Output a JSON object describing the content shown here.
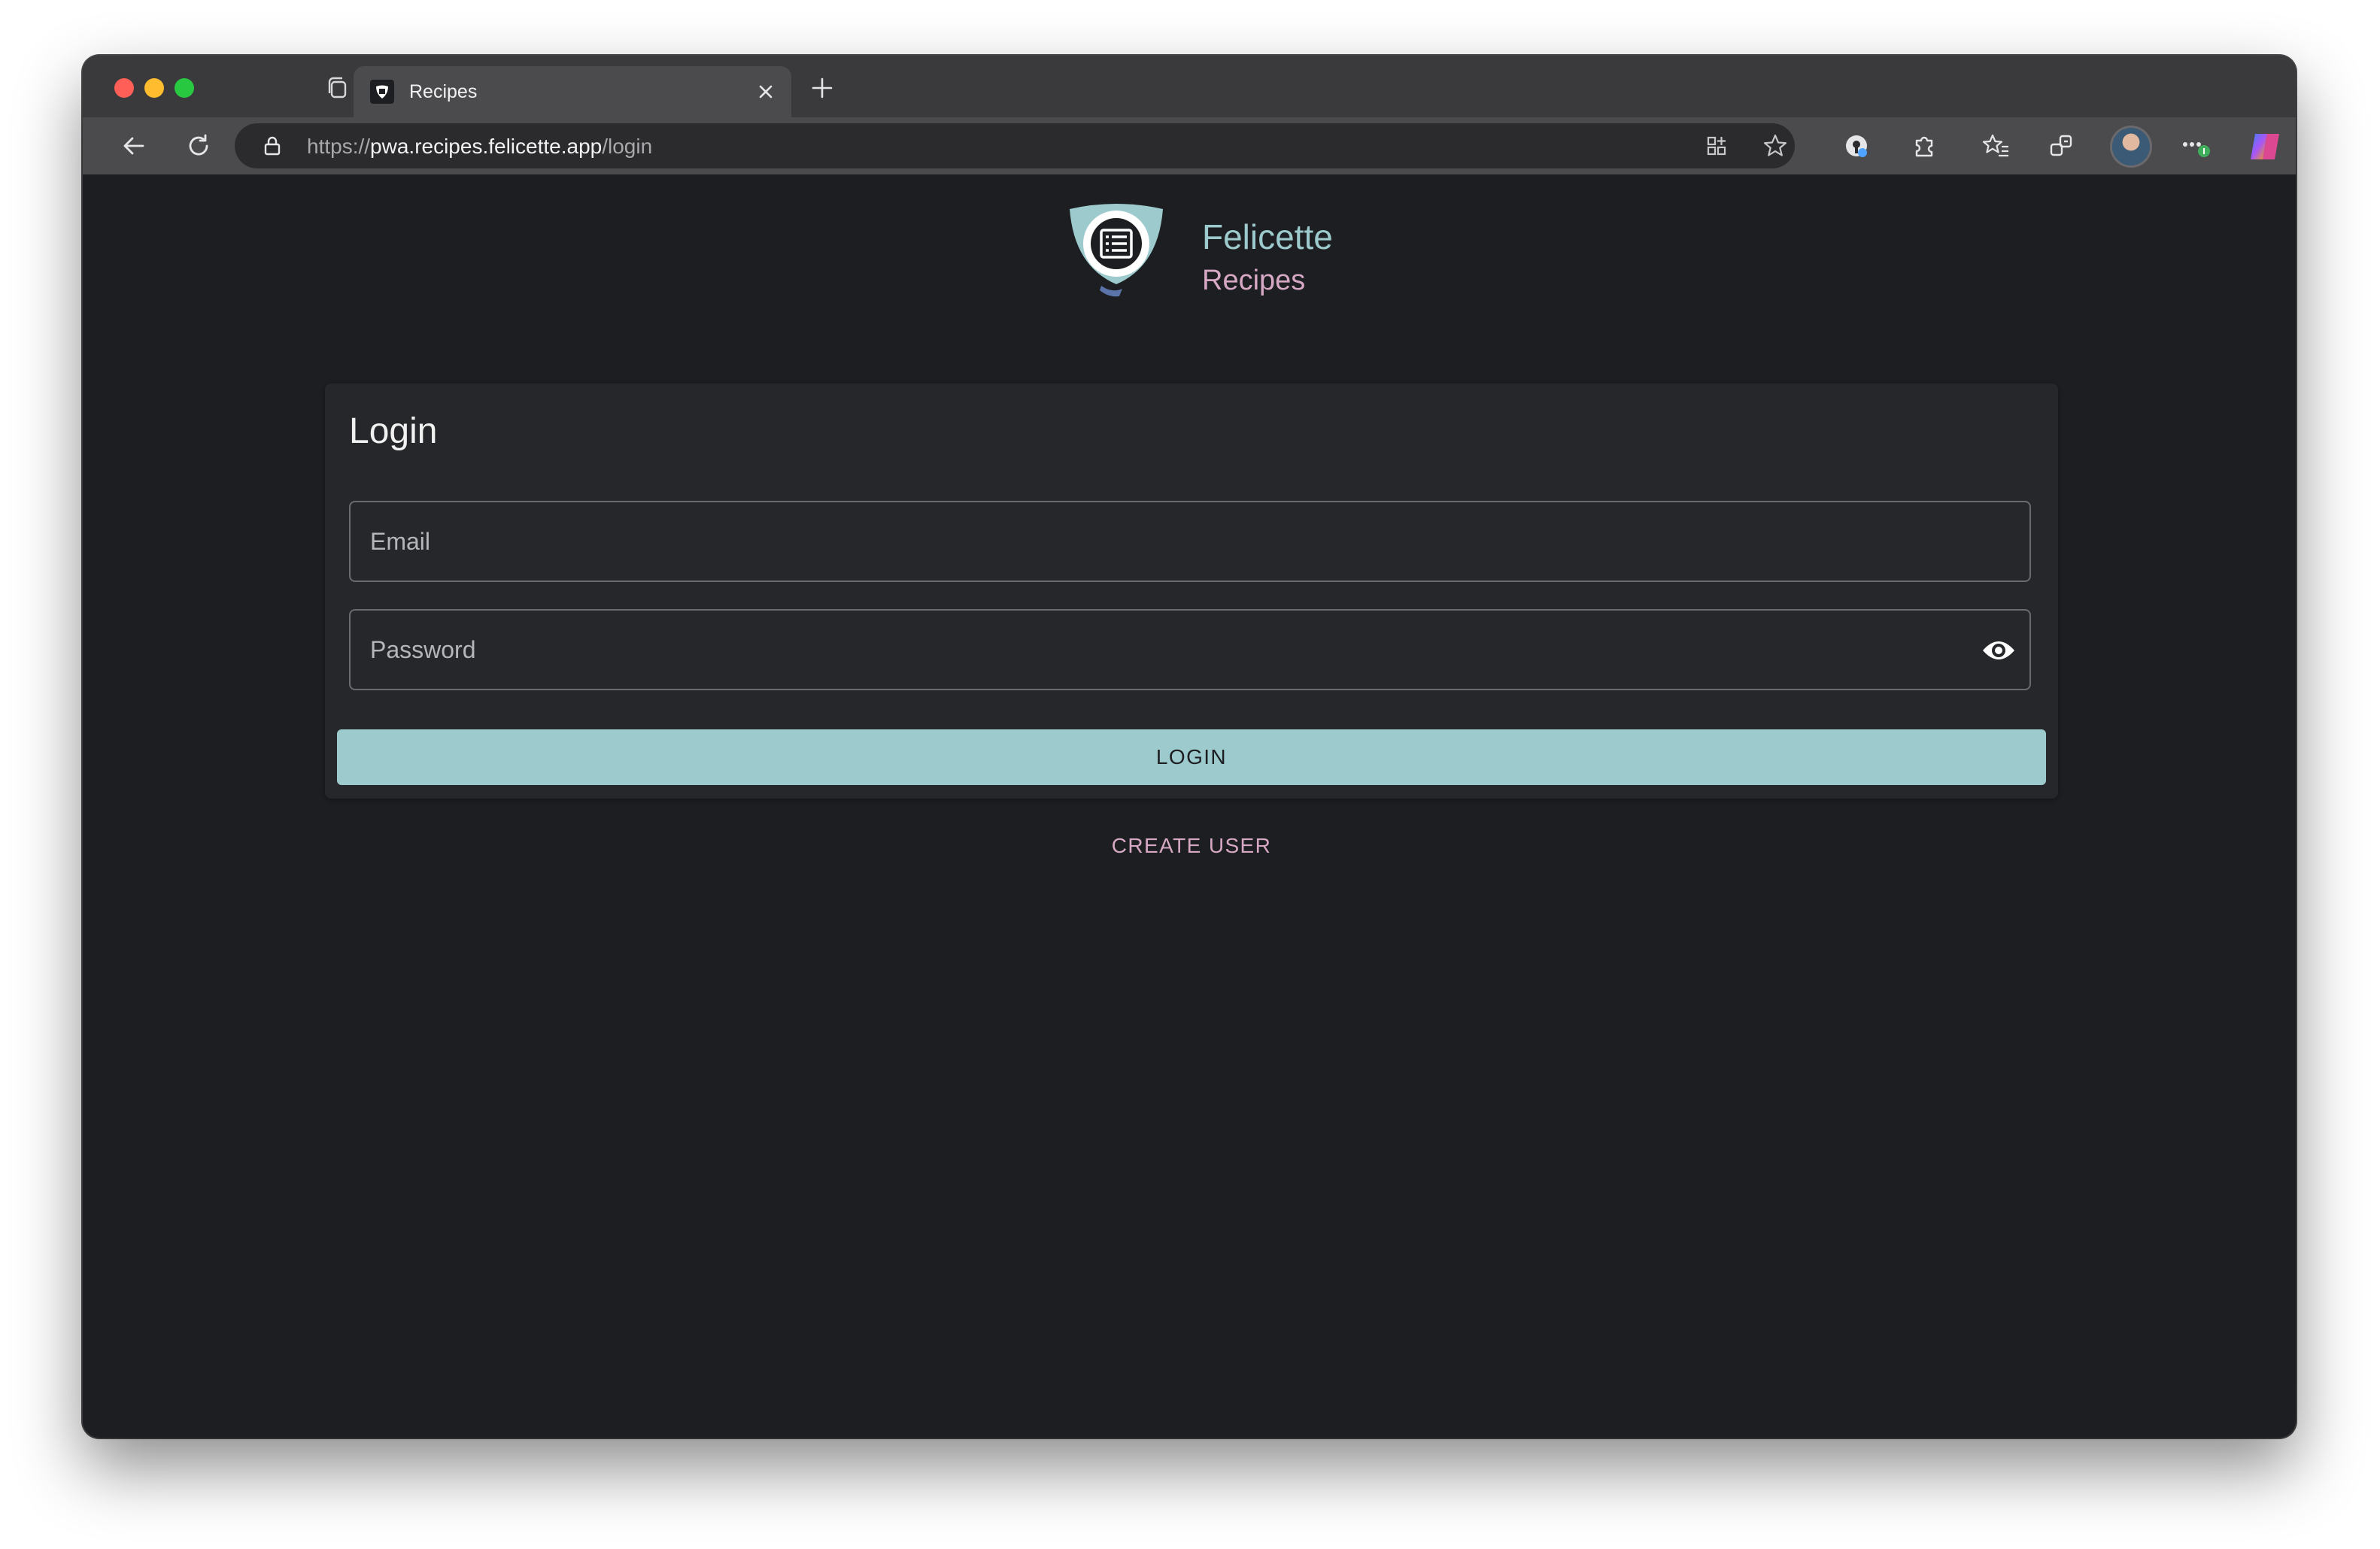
{
  "browser": {
    "tab": {
      "title": "Recipes"
    },
    "address": {
      "scheme": "https://",
      "host": "pwa.recipes.felicette.app",
      "path": "/login"
    },
    "icons": {
      "workspaces": "workspaces-icon",
      "vertical_tabs": "vertical-tabs-icon",
      "close_tab": "close-icon",
      "new_tab": "plus-icon",
      "back": "back-arrow-icon",
      "reload": "reload-icon",
      "lock": "lock-icon",
      "app_available": "app-available-icon",
      "favorite": "star-icon",
      "password_manager": "password-manager-icon",
      "extensions": "puzzle-icon",
      "favorites": "favorites-icon",
      "collections": "collections-icon",
      "profile": "avatar",
      "more": "more-icon",
      "copilot": "copilot-icon"
    }
  },
  "app": {
    "brand": {
      "name": "Felicette",
      "subtitle": "Recipes"
    },
    "login_card": {
      "title": "Login",
      "email": {
        "placeholder": "Email",
        "value": ""
      },
      "password": {
        "placeholder": "Password",
        "value": ""
      },
      "submit_label": "LOGIN"
    },
    "create_user_label": "CREATE USER"
  },
  "colors": {
    "background": "#1d1e21",
    "card": "#26272b",
    "primary": "#9ccacd",
    "secondary": "#d6a8c4"
  }
}
